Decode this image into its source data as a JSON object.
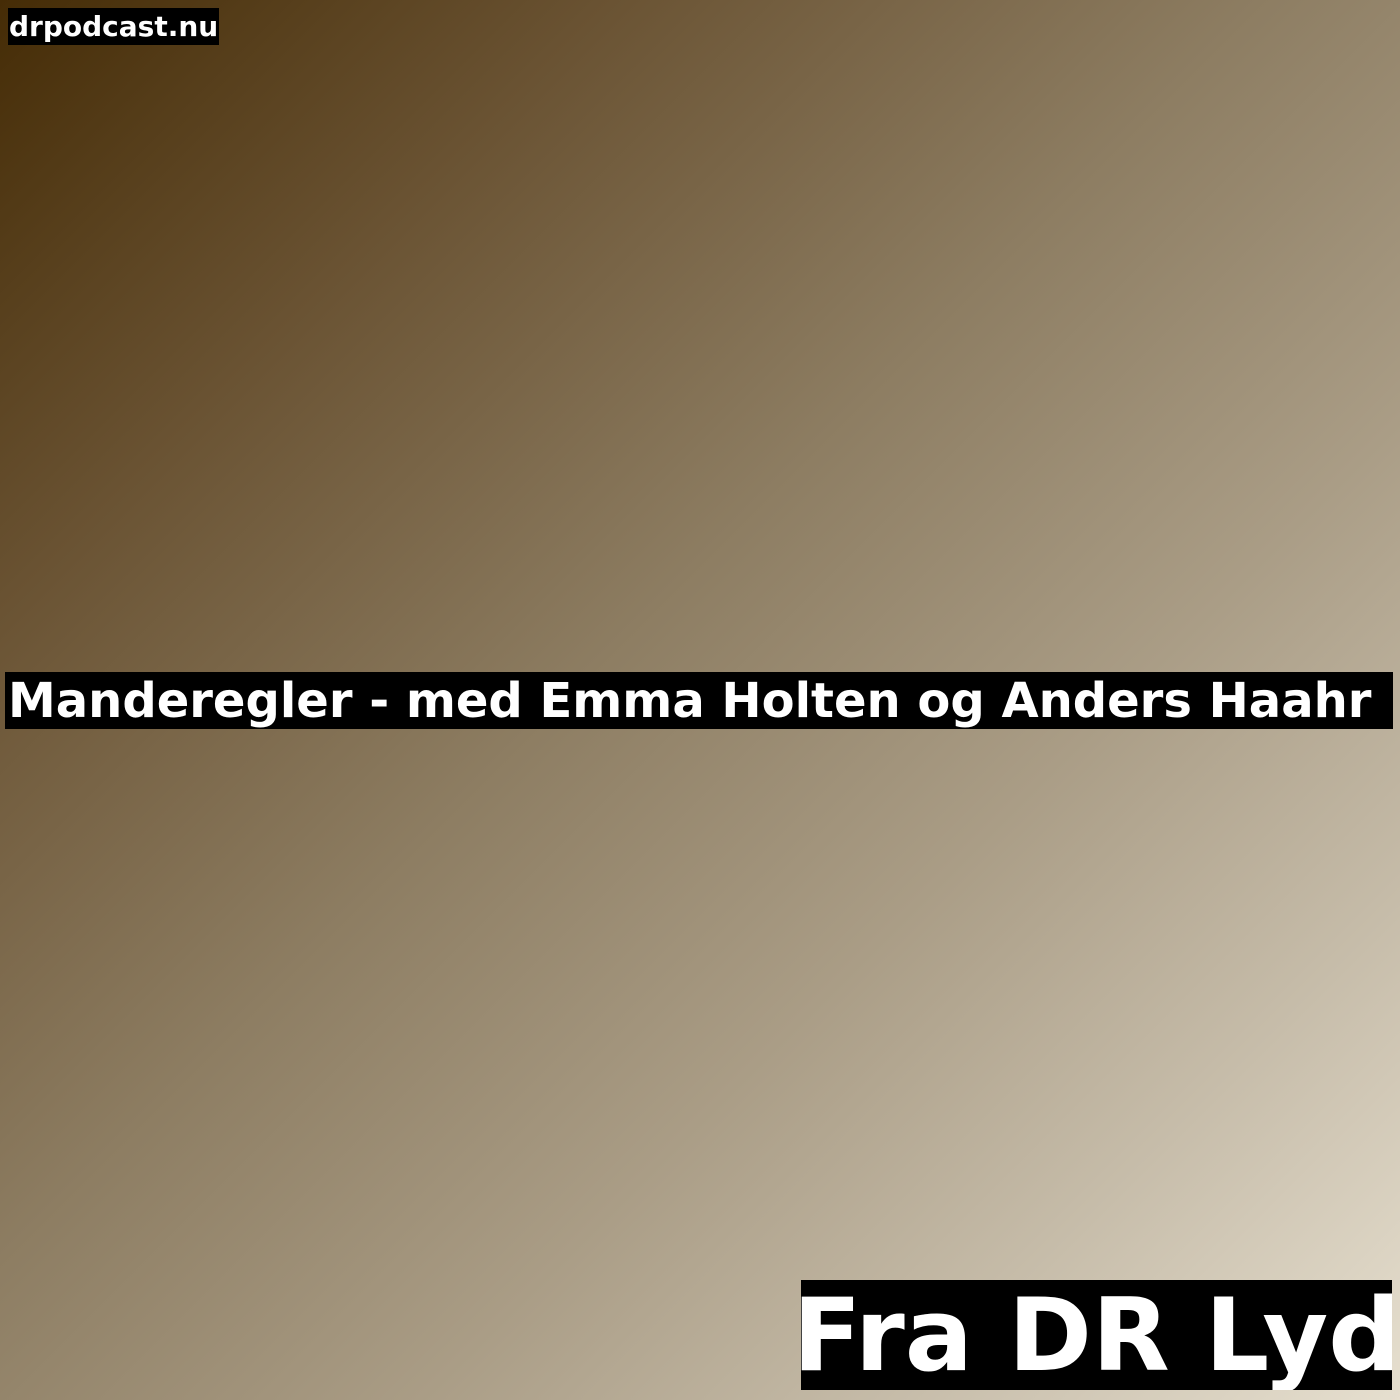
{
  "site_label": "drpodcast.nu",
  "title": "Manderegler - med Emma Holten og Anders Haahr",
  "source_tag": "Fra DR Lyd",
  "colors": {
    "gradient_start": "#452c06",
    "gradient_end": "#e6dfcf",
    "label_background": "#000000",
    "label_text": "#ffffff"
  }
}
